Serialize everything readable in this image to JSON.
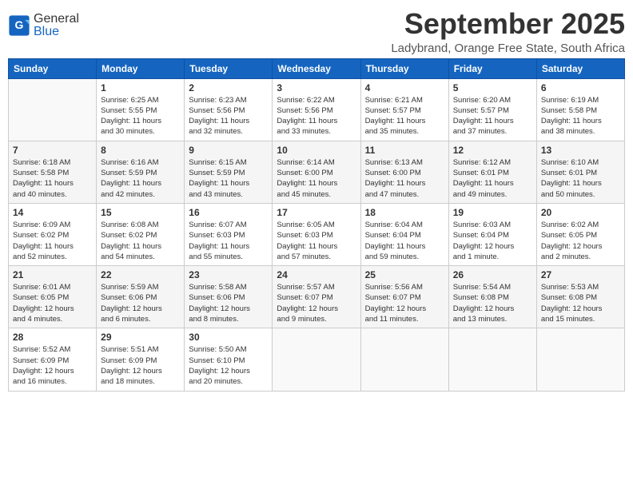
{
  "header": {
    "logo_general": "General",
    "logo_blue": "Blue",
    "month": "September 2025",
    "location": "Ladybrand, Orange Free State, South Africa"
  },
  "weekdays": [
    "Sunday",
    "Monday",
    "Tuesday",
    "Wednesday",
    "Thursday",
    "Friday",
    "Saturday"
  ],
  "weeks": [
    [
      {
        "day": "",
        "info": ""
      },
      {
        "day": "1",
        "info": "Sunrise: 6:25 AM\nSunset: 5:55 PM\nDaylight: 11 hours\nand 30 minutes."
      },
      {
        "day": "2",
        "info": "Sunrise: 6:23 AM\nSunset: 5:56 PM\nDaylight: 11 hours\nand 32 minutes."
      },
      {
        "day": "3",
        "info": "Sunrise: 6:22 AM\nSunset: 5:56 PM\nDaylight: 11 hours\nand 33 minutes."
      },
      {
        "day": "4",
        "info": "Sunrise: 6:21 AM\nSunset: 5:57 PM\nDaylight: 11 hours\nand 35 minutes."
      },
      {
        "day": "5",
        "info": "Sunrise: 6:20 AM\nSunset: 5:57 PM\nDaylight: 11 hours\nand 37 minutes."
      },
      {
        "day": "6",
        "info": "Sunrise: 6:19 AM\nSunset: 5:58 PM\nDaylight: 11 hours\nand 38 minutes."
      }
    ],
    [
      {
        "day": "7",
        "info": "Sunrise: 6:18 AM\nSunset: 5:58 PM\nDaylight: 11 hours\nand 40 minutes."
      },
      {
        "day": "8",
        "info": "Sunrise: 6:16 AM\nSunset: 5:59 PM\nDaylight: 11 hours\nand 42 minutes."
      },
      {
        "day": "9",
        "info": "Sunrise: 6:15 AM\nSunset: 5:59 PM\nDaylight: 11 hours\nand 43 minutes."
      },
      {
        "day": "10",
        "info": "Sunrise: 6:14 AM\nSunset: 6:00 PM\nDaylight: 11 hours\nand 45 minutes."
      },
      {
        "day": "11",
        "info": "Sunrise: 6:13 AM\nSunset: 6:00 PM\nDaylight: 11 hours\nand 47 minutes."
      },
      {
        "day": "12",
        "info": "Sunrise: 6:12 AM\nSunset: 6:01 PM\nDaylight: 11 hours\nand 49 minutes."
      },
      {
        "day": "13",
        "info": "Sunrise: 6:10 AM\nSunset: 6:01 PM\nDaylight: 11 hours\nand 50 minutes."
      }
    ],
    [
      {
        "day": "14",
        "info": "Sunrise: 6:09 AM\nSunset: 6:02 PM\nDaylight: 11 hours\nand 52 minutes."
      },
      {
        "day": "15",
        "info": "Sunrise: 6:08 AM\nSunset: 6:02 PM\nDaylight: 11 hours\nand 54 minutes."
      },
      {
        "day": "16",
        "info": "Sunrise: 6:07 AM\nSunset: 6:03 PM\nDaylight: 11 hours\nand 55 minutes."
      },
      {
        "day": "17",
        "info": "Sunrise: 6:05 AM\nSunset: 6:03 PM\nDaylight: 11 hours\nand 57 minutes."
      },
      {
        "day": "18",
        "info": "Sunrise: 6:04 AM\nSunset: 6:04 PM\nDaylight: 11 hours\nand 59 minutes."
      },
      {
        "day": "19",
        "info": "Sunrise: 6:03 AM\nSunset: 6:04 PM\nDaylight: 12 hours\nand 1 minute."
      },
      {
        "day": "20",
        "info": "Sunrise: 6:02 AM\nSunset: 6:05 PM\nDaylight: 12 hours\nand 2 minutes."
      }
    ],
    [
      {
        "day": "21",
        "info": "Sunrise: 6:01 AM\nSunset: 6:05 PM\nDaylight: 12 hours\nand 4 minutes."
      },
      {
        "day": "22",
        "info": "Sunrise: 5:59 AM\nSunset: 6:06 PM\nDaylight: 12 hours\nand 6 minutes."
      },
      {
        "day": "23",
        "info": "Sunrise: 5:58 AM\nSunset: 6:06 PM\nDaylight: 12 hours\nand 8 minutes."
      },
      {
        "day": "24",
        "info": "Sunrise: 5:57 AM\nSunset: 6:07 PM\nDaylight: 12 hours\nand 9 minutes."
      },
      {
        "day": "25",
        "info": "Sunrise: 5:56 AM\nSunset: 6:07 PM\nDaylight: 12 hours\nand 11 minutes."
      },
      {
        "day": "26",
        "info": "Sunrise: 5:54 AM\nSunset: 6:08 PM\nDaylight: 12 hours\nand 13 minutes."
      },
      {
        "day": "27",
        "info": "Sunrise: 5:53 AM\nSunset: 6:08 PM\nDaylight: 12 hours\nand 15 minutes."
      }
    ],
    [
      {
        "day": "28",
        "info": "Sunrise: 5:52 AM\nSunset: 6:09 PM\nDaylight: 12 hours\nand 16 minutes."
      },
      {
        "day": "29",
        "info": "Sunrise: 5:51 AM\nSunset: 6:09 PM\nDaylight: 12 hours\nand 18 minutes."
      },
      {
        "day": "30",
        "info": "Sunrise: 5:50 AM\nSunset: 6:10 PM\nDaylight: 12 hours\nand 20 minutes."
      },
      {
        "day": "",
        "info": ""
      },
      {
        "day": "",
        "info": ""
      },
      {
        "day": "",
        "info": ""
      },
      {
        "day": "",
        "info": ""
      }
    ]
  ]
}
